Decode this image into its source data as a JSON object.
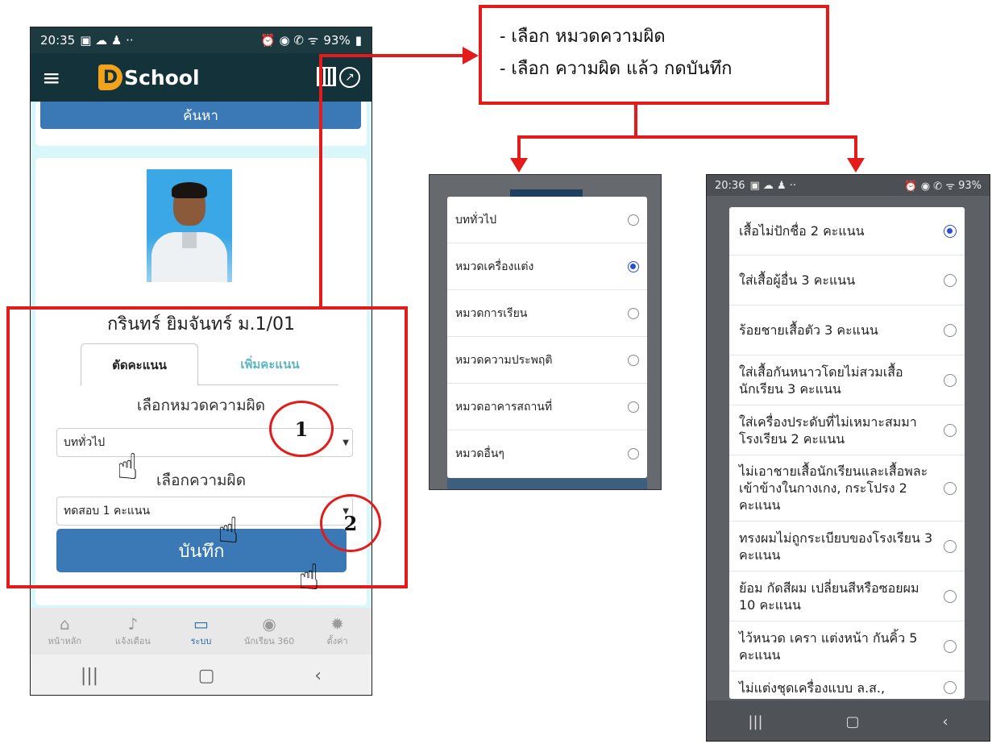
{
  "left_phone": {
    "status": {
      "time": "20:35",
      "battery": "93%"
    },
    "app_title": "School",
    "logo_letter": "D",
    "search_button": "ค้นหา",
    "student_name": "กรินทร์ ยิมจันทร์ ม.1/01",
    "tabs": {
      "active": "ตัดคะแนน",
      "inactive": "เพิ่มคะแนน"
    },
    "category_label": "เลือกหมวดความผิด",
    "category_value": "บททั่วไป",
    "offense_label": "เลือกความผิด",
    "offense_value": "ทดสอบ 1 คะแนน",
    "save_button": "บันทึก",
    "bottom_nav": [
      {
        "label": "หน้าหลัก",
        "icon": "home-icon"
      },
      {
        "label": "แจ้งเตือน",
        "icon": "bell-icon"
      },
      {
        "label": "ระบบ",
        "icon": "monitor-icon"
      },
      {
        "label": "นักเรียน 360",
        "icon": "user-circle-icon"
      },
      {
        "label": "ตั้งค่า",
        "icon": "gear-icon"
      }
    ]
  },
  "annotations": {
    "note_lines": [
      "-  เลือก หมวดความผิด",
      "-  เลือก ความผิด แล้ว กดบันทึก"
    ],
    "step1": "1",
    "step2": "2",
    "color": "#e41b1b"
  },
  "category_popup": {
    "items": [
      {
        "label": "บททั่วไป",
        "checked": false
      },
      {
        "label": "หมวดเครื่องแต่ง",
        "checked": true
      },
      {
        "label": "หมวดการเรียน",
        "checked": false
      },
      {
        "label": "หมวดความประพฤติ",
        "checked": false
      },
      {
        "label": "หมวดอาคารสถานที่",
        "checked": false
      },
      {
        "label": "หมวดอื่นๆ",
        "checked": false
      }
    ]
  },
  "offense_popup": {
    "status": {
      "time": "20:36",
      "battery": "93%"
    },
    "items": [
      {
        "label": "เสื้อไม่ปักชื่อ 2 คะแนน",
        "checked": true
      },
      {
        "label": "ใส่เสื้อผู้อื่น 3 คะแนน",
        "checked": false
      },
      {
        "label": "ร้อยชายเสื้อตัว 3 คะแนน",
        "checked": false
      },
      {
        "label": "ใส่เสื้อกันหนาวโดยไม่สวมเสื้อนักเรียน 3 คะแนน",
        "checked": false
      },
      {
        "label": "ใส่เครื่องประดับที่ไม่เหมาะสมมาโรงเรียน 2 คะแนน",
        "checked": false
      },
      {
        "label": "ไม่เอาชายเสื้อนักเรียนและเสื้อพละเข้าข้างในกางเกง, กระโปรง 2 คะแนน",
        "checked": false
      },
      {
        "label": "ทรงผมไม่ถูกระเบียบของโรงเรียน 3 คะแนน",
        "checked": false
      },
      {
        "label": "ย้อม กัดสีผม เปลี่ยนสีหรือซอยผม 10 คะแนน",
        "checked": false
      },
      {
        "label": "ไว้หนวด เครา แต่งหน้า กันคิ้ว 5 คะแนน",
        "checked": false
      },
      {
        "label": "ไม่แต่งชุดเครื่องแบบ ล.ส.,",
        "checked": false
      }
    ]
  }
}
